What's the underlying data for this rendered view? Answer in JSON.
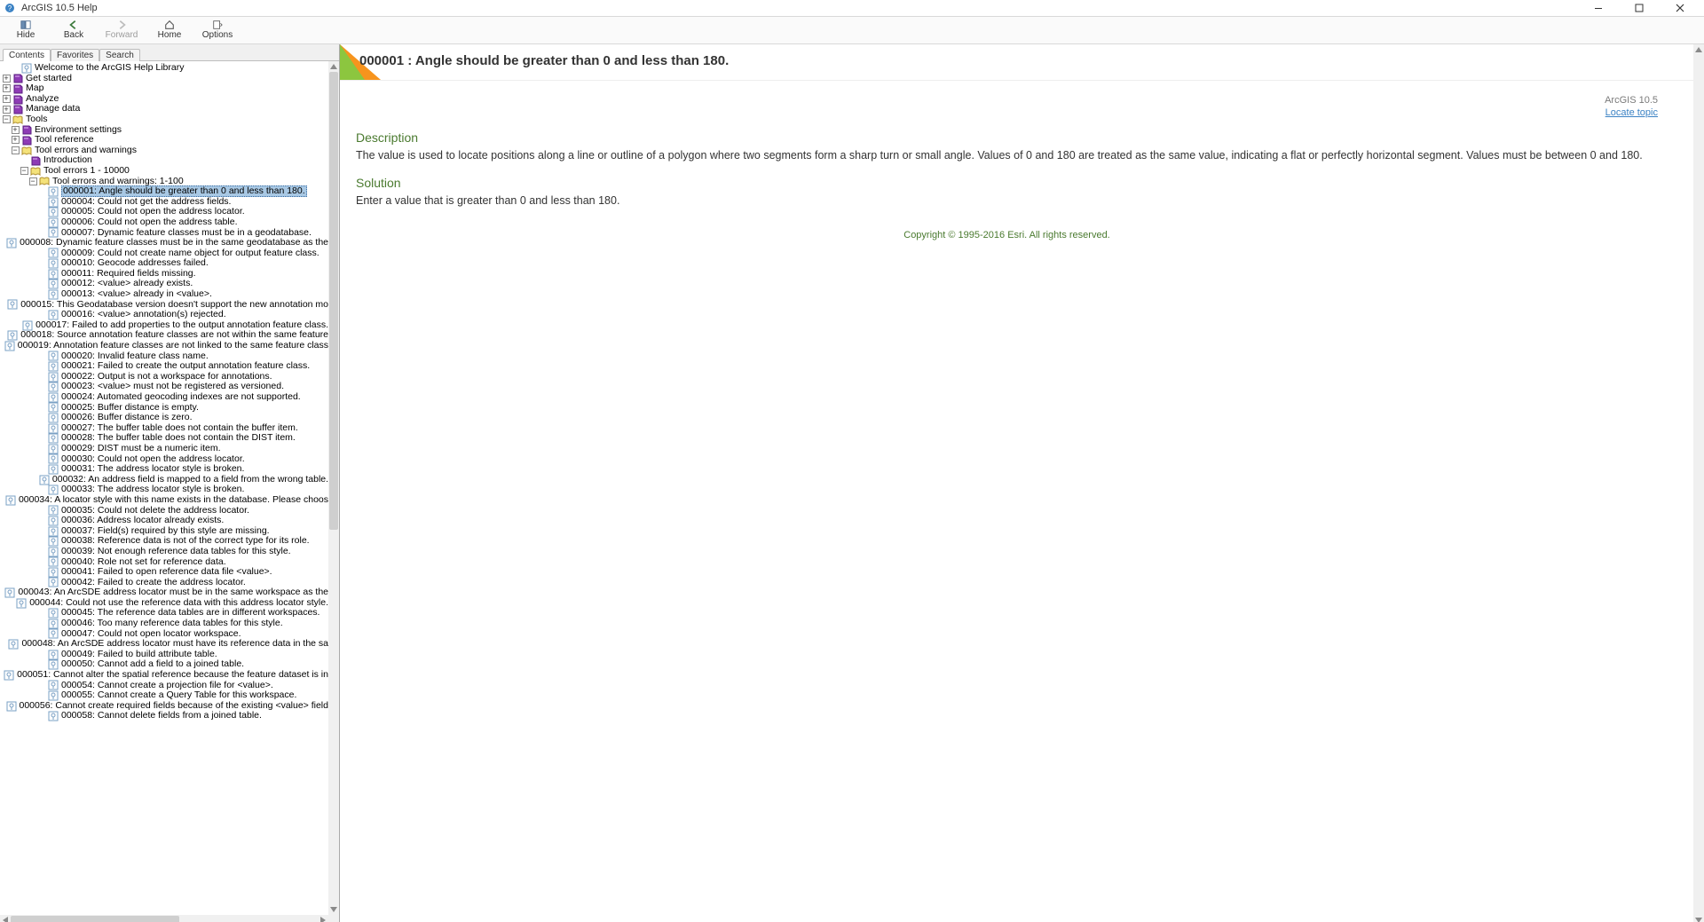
{
  "window": {
    "title": "ArcGIS 10.5 Help"
  },
  "toolbar": {
    "hide": {
      "label": "Hide",
      "accel": "H"
    },
    "back": {
      "label": "Back",
      "accel": "B"
    },
    "forward": {
      "label": "Forward",
      "accel": "F",
      "disabled": true
    },
    "home": {
      "label": "Home",
      "accel": "m"
    },
    "options": {
      "label": "Options",
      "accel": "O"
    }
  },
  "tabs": [
    {
      "label": "Contents",
      "accel": "C",
      "active": true
    },
    {
      "label": "Favorites",
      "accel": "i",
      "active": false
    },
    {
      "label": "Search",
      "accel": "S",
      "active": false
    }
  ],
  "tree": {
    "welcome": {
      "label": "Welcome to the ArcGIS Help Library"
    },
    "top_books": [
      {
        "label": "Get started",
        "expanded": false
      },
      {
        "label": "Map",
        "expanded": false
      },
      {
        "label": "Analyze",
        "expanded": false
      },
      {
        "label": "Manage data",
        "expanded": false
      }
    ],
    "tools": {
      "label": "Tools",
      "expanded": true,
      "children": [
        {
          "label": "Environment settings",
          "type": "book-closed",
          "expandable": true
        },
        {
          "label": "Tool reference",
          "type": "book-closed",
          "expandable": true
        },
        {
          "label": "Tool errors and warnings",
          "type": "book-open",
          "expanded": true,
          "children": [
            {
              "label": "Introduction",
              "type": "book-closed",
              "expandable": false
            },
            {
              "label": "Tool errors 1 - 10000",
              "type": "book-open",
              "expanded": true,
              "children": [
                {
                  "label": "Tool errors and warnings: 1-100",
                  "type": "book-open",
                  "expanded": true,
                  "topics": [
                    {
                      "label": "000001: Angle should be greater than 0 and less than 180.",
                      "selected": true
                    },
                    {
                      "label": "000004: Could not get the address fields."
                    },
                    {
                      "label": "000005: Could not open the address locator."
                    },
                    {
                      "label": "000006: Could not open the address table."
                    },
                    {
                      "label": "000007: Dynamic feature classes must be in a geodatabase."
                    },
                    {
                      "label": "000008: Dynamic feature classes must be in the same geodatabase as the"
                    },
                    {
                      "label": "000009: Could not create name object for output feature class."
                    },
                    {
                      "label": "000010: Geocode addresses failed."
                    },
                    {
                      "label": "000011: Required fields missing."
                    },
                    {
                      "label": "000012: <value> already exists."
                    },
                    {
                      "label": "000013: <value> already in <value>."
                    },
                    {
                      "label": "000015: This Geodatabase version doesn't support the new annotation mo"
                    },
                    {
                      "label": "000016: <value> annotation(s) rejected."
                    },
                    {
                      "label": "000017: Failed to add properties to the output annotation feature class."
                    },
                    {
                      "label": "000018: Source annotation feature classes are not within the same feature"
                    },
                    {
                      "label": "000019: Annotation feature classes are not linked to the same feature class"
                    },
                    {
                      "label": "000020: Invalid feature class name."
                    },
                    {
                      "label": "000021: Failed to create the output annotation feature class."
                    },
                    {
                      "label": "000022: Output is not a workspace for annotations."
                    },
                    {
                      "label": "000023: <value> must not be registered as versioned."
                    },
                    {
                      "label": "000024: Automated geocoding indexes are not supported."
                    },
                    {
                      "label": "000025: Buffer distance is empty."
                    },
                    {
                      "label": "000026: Buffer distance is zero."
                    },
                    {
                      "label": "000027: The buffer table does not contain the buffer item."
                    },
                    {
                      "label": "000028: The buffer table does not contain the DIST item."
                    },
                    {
                      "label": "000029: DIST must be a numeric item."
                    },
                    {
                      "label": "000030: Could not open the address locator."
                    },
                    {
                      "label": "000031: The address locator style is broken."
                    },
                    {
                      "label": "000032: An address field is mapped to a field from the wrong table."
                    },
                    {
                      "label": "000033: The address locator style is broken."
                    },
                    {
                      "label": "000034: A locator style with this name exists in the database. Please choos"
                    },
                    {
                      "label": "000035: Could not delete the address locator."
                    },
                    {
                      "label": "000036: Address locator already exists."
                    },
                    {
                      "label": "000037: Field(s) required by this style are missing."
                    },
                    {
                      "label": "000038: Reference data is not of the correct type for its role."
                    },
                    {
                      "label": "000039: Not enough reference data tables for this style."
                    },
                    {
                      "label": "000040: Role not set for reference data."
                    },
                    {
                      "label": "000041: Failed to open reference data file <value>."
                    },
                    {
                      "label": "000042: Failed to create the address locator."
                    },
                    {
                      "label": "000043: An ArcSDE address locator must be in the same workspace as the"
                    },
                    {
                      "label": "000044: Could not use the reference data with this address locator style."
                    },
                    {
                      "label": "000045: The reference data tables are in different workspaces."
                    },
                    {
                      "label": "000046: Too many reference data tables for this style."
                    },
                    {
                      "label": "000047: Could not open locator workspace."
                    },
                    {
                      "label": "000048: An ArcSDE address locator must have its reference data in the sa"
                    },
                    {
                      "label": "000049: Failed to build attribute table."
                    },
                    {
                      "label": "000050: Cannot add a field to a joined table."
                    },
                    {
                      "label": "000051: Cannot alter the spatial reference because the feature dataset is in"
                    },
                    {
                      "label": "000054: Cannot create a projection file for <value>."
                    },
                    {
                      "label": "000055: Cannot create a Query Table for this workspace."
                    },
                    {
                      "label": "000056: Cannot create required fields because of the existing <value> field"
                    },
                    {
                      "label": "000058: Cannot delete fields from a joined table."
                    }
                  ]
                }
              ]
            }
          ]
        }
      ]
    }
  },
  "article": {
    "title": "000001 : Angle should be greater than 0 and less than 180.",
    "version": "ArcGIS 10.5",
    "locate_link": "Locate topic",
    "sections": {
      "description": {
        "heading": "Description",
        "text": "The value is used to locate positions along a line or outline of a polygon where two segments form a sharp turn or small angle. Values of 0 and 180 are treated as the same value, indicating a flat or perfectly horizontal segment. Values must be between 0 and 180."
      },
      "solution": {
        "heading": "Solution",
        "text": "Enter a value that is greater than 0 and less than 180."
      }
    },
    "copyright": "Copyright © 1995-2016 Esri. All rights reserved."
  }
}
